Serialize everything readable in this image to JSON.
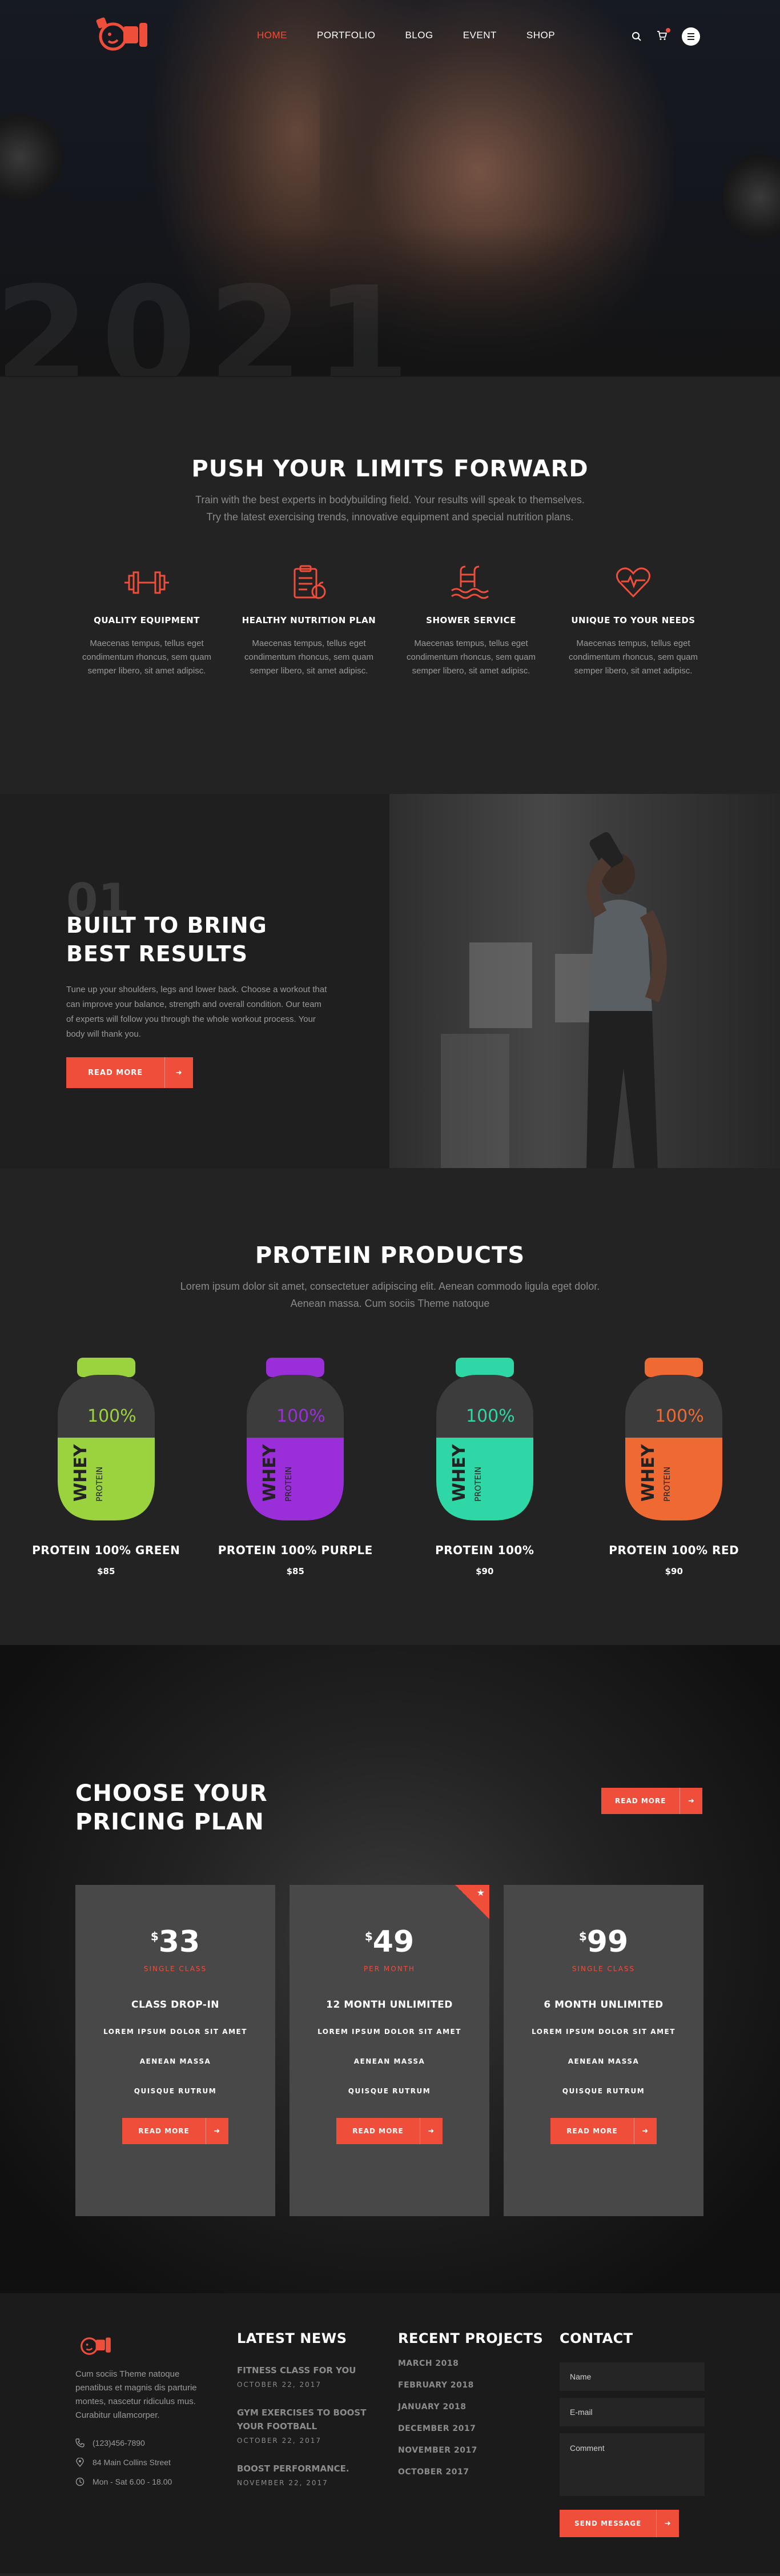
{
  "colors": {
    "accent": "#ef4e3b",
    "background": "#232323",
    "card": "#484848"
  },
  "hero": {
    "nav": [
      {
        "label": "HOME",
        "active": true
      },
      {
        "label": "PORTFOLIO"
      },
      {
        "label": "BLOG"
      },
      {
        "label": "EVENT"
      },
      {
        "label": "SHOP"
      }
    ],
    "year": "2021"
  },
  "features": {
    "title": "PUSH YOUR LIMITS FORWARD",
    "subtitle": "Train with the best experts in bodybuilding field. Your results will speak to themselves. Try the latest exercising trends, innovative equipment and special nutrition plans.",
    "items": [
      {
        "icon": "dumbbell-icon",
        "title": "QUALITY EQUIPMENT",
        "text": "Maecenas tempus, tellus eget condimentum rhoncus, sem quam semper libero, sit amet adipisc."
      },
      {
        "icon": "clipboard-apple-icon",
        "title": "HEALTHY NUTRITION PLAN",
        "text": "Maecenas tempus, tellus eget condimentum rhoncus, sem quam semper libero, sit amet adipisc."
      },
      {
        "icon": "pool-ladder-icon",
        "title": "SHOWER SERVICE",
        "text": "Maecenas tempus, tellus eget condimentum rhoncus, sem quam semper libero, sit amet adipisc."
      },
      {
        "icon": "heart-pulse-icon",
        "title": "UNIQUE TO YOUR NEEDS",
        "text": "Maecenas tempus, tellus eget condimentum rhoncus, sem quam semper libero, sit amet adipisc."
      }
    ]
  },
  "built": {
    "number": "01",
    "title_line1": "BUILT TO BRING",
    "title_line2": "BEST RESULTS",
    "text": "Tune up your shoulders, legs and lower back. Choose a workout that can improve your balance, strength and overall condition. Our team of experts will follow you through the whole workout process. Your body will thank you.",
    "button": "READ MORE"
  },
  "protein": {
    "title": "PROTEIN PRODUCTS",
    "subtitle": "Lorem ipsum dolor sit amet, consectetuer adipiscing elit. Aenean commodo ligula eget dolor. Aenean massa. Cum sociis Theme natoque",
    "products": [
      {
        "name": "PROTEIN 100% GREEN",
        "price": "$85",
        "color": "#9bd33e"
      },
      {
        "name": "PROTEIN 100% PURPLE",
        "price": "$85",
        "color": "#9a2fd9"
      },
      {
        "name": "PROTEIN 100%",
        "price": "$90",
        "color": "#2fd6a6"
      },
      {
        "name": "PROTEIN 100% RED",
        "price": "$90",
        "color": "#ef6a32"
      }
    ],
    "jar_label_percent": "100%",
    "jar_label_whey": "WHEY",
    "jar_label_protein": "PROTEIN"
  },
  "pricing": {
    "title_line1": "CHOOSE YOUR",
    "title_line2": "PRICING PLAN",
    "top_button": "READ MORE",
    "plans": [
      {
        "currency": "$",
        "amount": "33",
        "period": "SINGLE CLASS",
        "name": "CLASS DROP-IN",
        "features": [
          "LOREM IPSUM DOLOR SIT AMET",
          "AENEAN MASSA",
          "QUISQUE RUTRUM"
        ],
        "button": "READ MORE",
        "featured": false
      },
      {
        "currency": "$",
        "amount": "49",
        "period": "PER MONTH",
        "name": "12 MONTH UNLIMITED",
        "features": [
          "LOREM IPSUM DOLOR SIT AMET",
          "AENEAN MASSA",
          "QUISQUE RUTRUM"
        ],
        "button": "READ MORE",
        "featured": true
      },
      {
        "currency": "$",
        "amount": "99",
        "period": "SINGLE CLASS",
        "name": "6 MONTH UNLIMITED",
        "features": [
          "LOREM IPSUM DOLOR SIT AMET",
          "AENEAN MASSA",
          "QUISQUE RUTRUM"
        ],
        "button": "READ MORE",
        "featured": false
      }
    ]
  },
  "footer": {
    "about": "Cum sociis Theme natoque penatibus et magnis dis parturie montes, nascetur ridiculus mus. Curabitur ullamcorper.",
    "phone": "(123)456-7890",
    "address": "84 Main Collins Street",
    "hours": "Mon - Sat 6.00 - 18.00",
    "news_title": "LATEST NEWS",
    "news": [
      {
        "title": "FITNESS CLASS FOR YOU",
        "date": "OCTOBER 22, 2017"
      },
      {
        "title": "GYM EXERCISES TO BOOST YOUR FOOTBALL",
        "date": "OCTOBER 22, 2017"
      },
      {
        "title": "BOOST PERFORMANCE.",
        "date": "NOVEMBER 22, 2017"
      }
    ],
    "projects_title": "RECENT PROJECTS",
    "projects": [
      "MARCH 2018",
      "FEBRUARY 2018",
      "JANUARY 2018",
      "DECEMBER 2017",
      "NOVEMBER 2017",
      "OCTOBER 2017"
    ],
    "contact_title": "CONTACT",
    "name_placeholder": "Name",
    "email_placeholder": "E-mail",
    "comment_placeholder": "Comment",
    "send_button": "SEND MESSAGE"
  }
}
